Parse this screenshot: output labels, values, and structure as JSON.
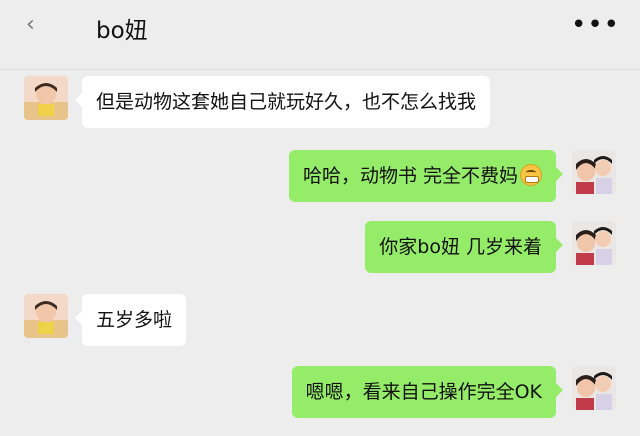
{
  "header": {
    "back_label": "‹",
    "title": "bo妞",
    "more_label": "•••"
  },
  "messages": [
    {
      "side": "in",
      "text": "但是动物这套她自己就玩好久，也不怎么找我"
    },
    {
      "side": "out",
      "text": "哈哈，动物书 完全不费妈",
      "emoji": "grinning-face"
    },
    {
      "side": "out",
      "text": "你家bo妞 几岁来着"
    },
    {
      "side": "in",
      "text": "五岁多啦"
    },
    {
      "side": "out",
      "text": "嗯嗯，看来自己操作完全OK"
    }
  ],
  "colors": {
    "background": "#ededed",
    "incoming_bubble": "#ffffff",
    "outgoing_bubble": "#95ec69"
  }
}
